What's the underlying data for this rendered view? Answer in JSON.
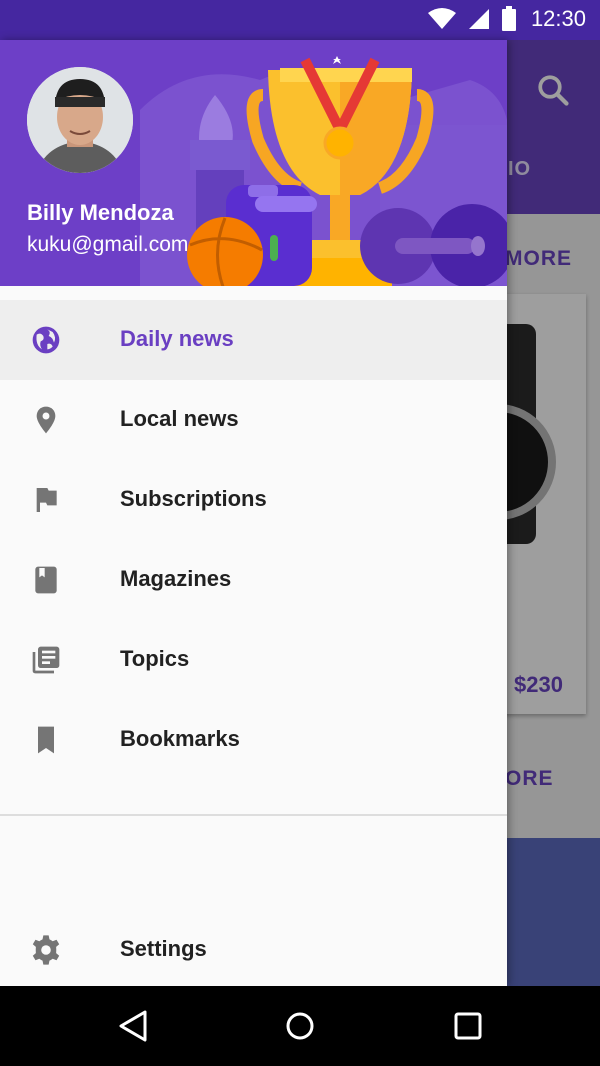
{
  "status_bar": {
    "time": "12:30"
  },
  "background_app": {
    "tab_label": "IO",
    "more_label_1": "MORE",
    "more_label_2": "ORE",
    "price": "$230"
  },
  "drawer": {
    "user": {
      "name": "Billy Mendoza",
      "email": "kuku@gmail.com"
    },
    "items": [
      {
        "label": "Daily news",
        "icon": "globe-icon",
        "active": true
      },
      {
        "label": "Local news",
        "icon": "location-pin-icon"
      },
      {
        "label": "Subscriptions",
        "icon": "flag-icon"
      },
      {
        "label": "Magazines",
        "icon": "book-icon"
      },
      {
        "label": "Topics",
        "icon": "library-books-icon"
      },
      {
        "label": "Bookmarks",
        "icon": "bookmark-icon"
      }
    ],
    "settings": {
      "label": "Settings",
      "icon": "gear-icon"
    }
  },
  "colors": {
    "accent": "#6a3fc2",
    "header_bg": "#6d3fc7",
    "status_bar": "#4527a0",
    "icon_gray": "#757575"
  }
}
